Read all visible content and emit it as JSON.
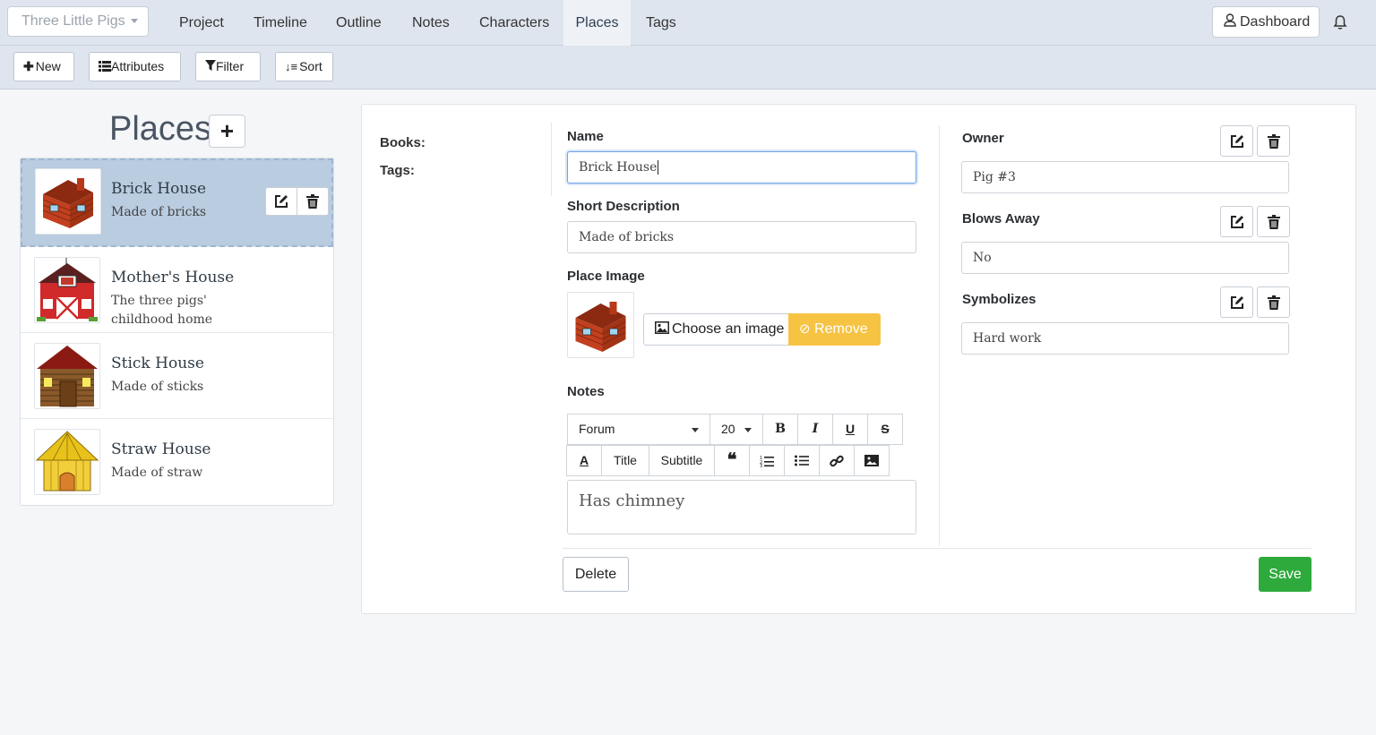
{
  "nav": {
    "story_select": "Three Little Pigs",
    "tabs": [
      "Project",
      "Timeline",
      "Outline",
      "Notes",
      "Characters",
      "Places",
      "Tags"
    ],
    "active_tab": "Places",
    "dashboard": "Dashboard"
  },
  "toolbar": {
    "new": "New",
    "attributes": "Attributes",
    "filter": "Filter",
    "sort": "Sort"
  },
  "list": {
    "title": "Places",
    "items": [
      {
        "name": "Brick House",
        "desc": "Made of bricks"
      },
      {
        "name": "Mother's House",
        "desc": "The three pigs' childhood home"
      },
      {
        "name": "Stick House",
        "desc": "Made of sticks"
      },
      {
        "name": "Straw House",
        "desc": "Made of straw"
      }
    ]
  },
  "editor": {
    "books_label": "Books:",
    "tags_label": "Tags:",
    "name_label": "Name",
    "name_value": "Brick House",
    "short_desc_label": "Short Description",
    "short_desc_value": "Made of bricks",
    "place_image_label": "Place Image",
    "choose_image": "Choose an image",
    "remove": "Remove",
    "notes_label": "Notes",
    "rte": {
      "font": "Forum",
      "size": "20",
      "title": "Title",
      "subtitle": "Subtitle"
    },
    "notes_value": "Has chimney",
    "delete": "Delete",
    "save": "Save"
  },
  "attributes": [
    {
      "label": "Owner",
      "value": "Pig #3"
    },
    {
      "label": "Blows Away",
      "value": "No"
    },
    {
      "label": "Symbolizes",
      "value": "Hard work"
    }
  ],
  "colors": {
    "save_green": "#2eaa3c",
    "remove_yellow": "#f6c343",
    "selected_bg": "#b9cce0",
    "topbar": "#dfe5ee"
  }
}
